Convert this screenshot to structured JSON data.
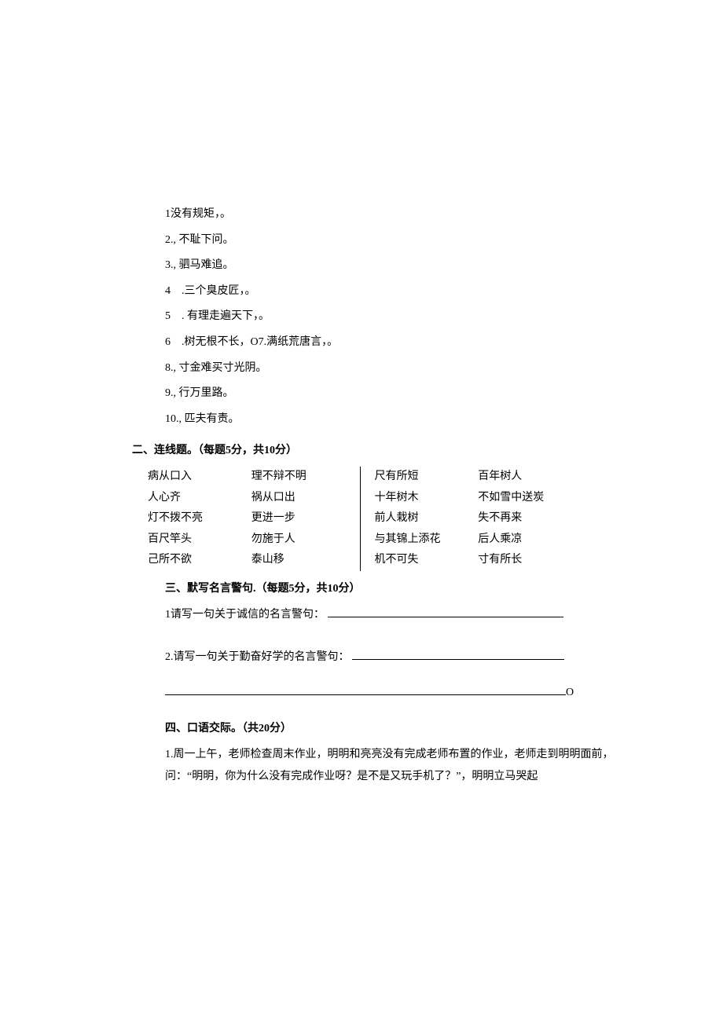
{
  "section1": {
    "items": [
      "1没有规矩，。",
      "2., 不耻下问。",
      "3., 驷马难追。",
      "4　.三个臭皮匠，。",
      "5　. 有理走遍天下，。",
      "6　.树无根不长，O7.满纸荒唐言，。",
      "8., 寸金难买寸光阴。",
      "9., 行万里路。",
      "10., 匹夫有责。"
    ]
  },
  "section2": {
    "header": "二、连线题。（每题5分，共10分）",
    "leftA": [
      "病从口入",
      "人心齐",
      "灯不拨不亮",
      "百尺竿头",
      "己所不欲"
    ],
    "leftB": [
      "理不辩不明",
      "祸从口出",
      "更进一步",
      "勿施于人",
      "泰山移"
    ],
    "rightA": [
      "尺有所短",
      "十年树木",
      "前人栽树",
      "与其锦上添花",
      "机不可失"
    ],
    "rightB": [
      "百年树人",
      "不如雪中送炭",
      "失不再来",
      "后人乘凉",
      "寸有所长"
    ]
  },
  "section3": {
    "header": "三、默写名言警句.（每题5分，共10分）",
    "q1": "1请写一句关于诚信的名言警句：",
    "q2": "2.请写一句关于勤奋好学的名言警句：",
    "trail": "O"
  },
  "section4": {
    "header": "四、口语交际。（共20分）",
    "p1": "1.周一上午，老师检查周末作业，明明和亮亮没有完成老师布置的作业，老师走到明明面前，",
    "p2": "问：“明明，你为什么没有完成作业呀？是不是又玩手机了？”，明明立马哭起"
  }
}
